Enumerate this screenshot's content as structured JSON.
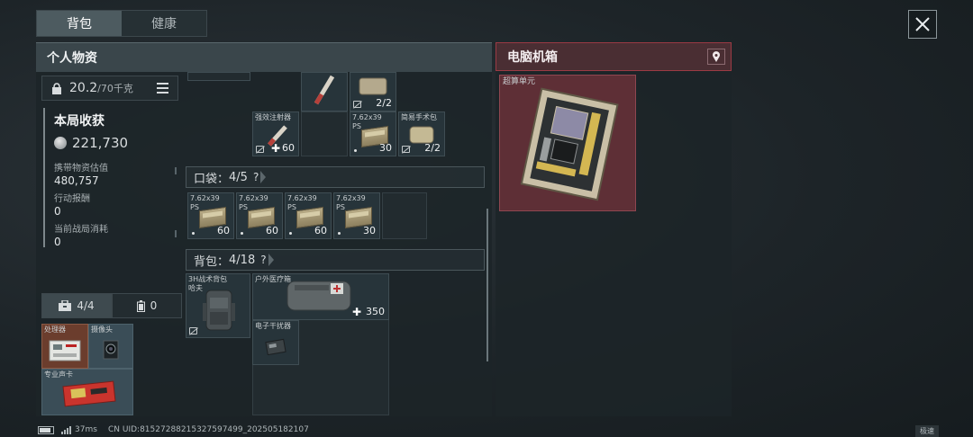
{
  "tabs": [
    "背包",
    "健康"
  ],
  "left_panel": {
    "title": "个人物资",
    "weight": {
      "current": "20.2",
      "max": "/70千克"
    },
    "gain_title": "本局收获",
    "gain_total": "221,730",
    "stats": [
      {
        "label": "携带物资估值",
        "value": "480,757"
      },
      {
        "label": "行动报酬",
        "value": "0"
      },
      {
        "label": "当前战局消耗",
        "value": "0"
      }
    ],
    "equip_tabs": [
      {
        "icon": "briefcase-icon",
        "count": "4/4"
      },
      {
        "icon": "battery-icon",
        "count": "0"
      }
    ],
    "case_items": [
      "处理器",
      "摄像头",
      "专业声卡"
    ]
  },
  "upper_items": {
    "injector": {
      "name": "强效注射器",
      "count": "60"
    },
    "kit_top_count": "2/2",
    "ammo": {
      "name": "7.62x39",
      "sub": "PS",
      "count": "30"
    },
    "surgery_kit": {
      "name": "简易手术包",
      "count": "2/2"
    }
  },
  "pocket": {
    "label": "口袋",
    "count": "4/5",
    "help": "?",
    "items": [
      {
        "name": "7.62x39",
        "sub": "PS",
        "count": "60"
      },
      {
        "name": "7.62x39",
        "sub": "PS",
        "count": "60"
      },
      {
        "name": "7.62x39",
        "sub": "PS",
        "count": "60"
      },
      {
        "name": "7.62x39",
        "sub": "PS",
        "count": "30"
      }
    ]
  },
  "backpack": {
    "label": "背包",
    "count": "4/18",
    "help": "?",
    "bag": {
      "name": "3H战术背包",
      "sub": "哈夫"
    },
    "medkit": {
      "name": "户外医疗箱",
      "count": "350"
    },
    "jammer": {
      "name": "电子干扰器"
    }
  },
  "right_panel": {
    "title": "电脑机箱",
    "item": {
      "name": "超算单元"
    }
  },
  "status_bar": {
    "ping": "37ms",
    "uid": "CN UID:81527288215327597499_202505182107",
    "quality": "极速"
  },
  "colors": {
    "accent_red": "#9b3a44",
    "active_tab": "#4d5b60",
    "panel": "#1c2428"
  }
}
